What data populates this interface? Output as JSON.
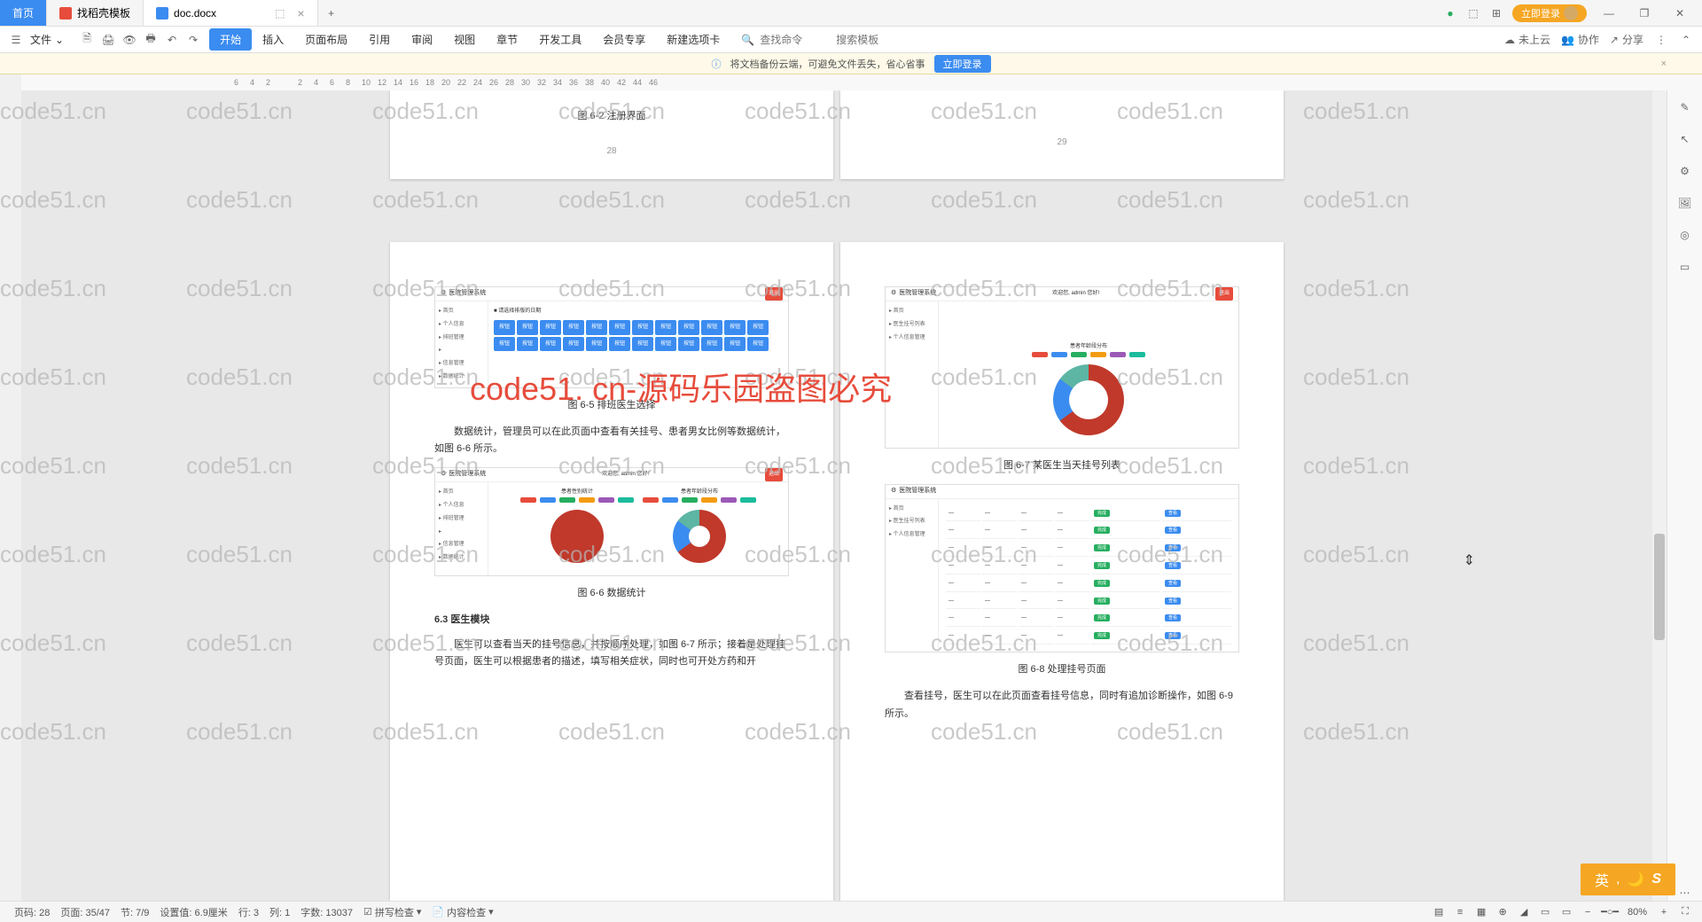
{
  "titlebar": {
    "home_tab": "首页",
    "template_tab": "找稻壳模板",
    "doc_tab": "doc.docx",
    "login_label": "立即登录"
  },
  "ribbon": {
    "file_label": "文件",
    "tabs": [
      "开始",
      "插入",
      "页面布局",
      "引用",
      "审阅",
      "视图",
      "章节",
      "开发工具",
      "会员专享",
      "新建选项卡"
    ],
    "search_cmd_placeholder": "查找命令",
    "search_tpl_placeholder": "搜索模板",
    "cloud_label": "未上云",
    "collab_label": "协作",
    "share_label": "分享"
  },
  "notif": {
    "text": "将文档备份云端，可避免文件丢失，省心省事",
    "btn": "立即登录"
  },
  "ruler_ticks": [
    "6",
    "4",
    "2",
    "",
    "2",
    "4",
    "6",
    "8",
    "10",
    "12",
    "14",
    "16",
    "18",
    "20",
    "22",
    "24",
    "26",
    "28",
    "30",
    "32",
    "34",
    "36",
    "38",
    "40",
    "42",
    "44",
    "46"
  ],
  "pages": {
    "p1_caption": "图 6-2 注册界面",
    "p1_num": "28",
    "p2_num": "29",
    "p3_caption": "图 6-5 排班医生选择",
    "p3_para": "数据统计，管理员可以在此页面中查看有关挂号、患者男女比例等数据统计，如图 6-6 所示。",
    "p3_caption2": "图 6-6 数据统计",
    "p3_section": "6.3 医生模块",
    "p3_para2": "医生可以查看当天的挂号信息，并按顺序处理，如图 6-7 所示；接着是处理挂号页面，医生可以根据患者的描述，填写相关症状，同时也可开处方药和开",
    "p4_caption": "图 6-7 某医生当天挂号列表",
    "p4_caption2": "图 6-8 处理挂号页面",
    "p4_para": "查看挂号，医生可以在此页面查看挂号信息，同时有追加诊断操作，如图 6-9 所示。",
    "mini_title": "医院管理系统",
    "mini_side_items": [
      "首页",
      "个人信息",
      "排班管理",
      "",
      "信息管理",
      "数据统计"
    ],
    "mini_side_items2": [
      "首页",
      "医生挂号列表",
      "个人信息管理"
    ],
    "legend_colors": [
      "#e74c3c",
      "#3b8cf0",
      "#27ae60",
      "#f39c12",
      "#9b59b6",
      "#1abc9c"
    ],
    "chart_label1": "患者性别统计",
    "chart_label2": "患者年龄段分布"
  },
  "statusbar": {
    "page_count": "页码: 28",
    "page_pos": "页面: 35/47",
    "section": "节: 7/9",
    "set_value": "设置值: 6.9厘米",
    "line": "行: 3",
    "col": "列: 1",
    "word_count": "字数: 13037",
    "spell_check": "拼写检查",
    "content_check": "内容检查",
    "zoom": "80%"
  },
  "overlay": "code51. cn-源码乐园盗图必究",
  "watermark": "code51.cn",
  "ime": "英"
}
